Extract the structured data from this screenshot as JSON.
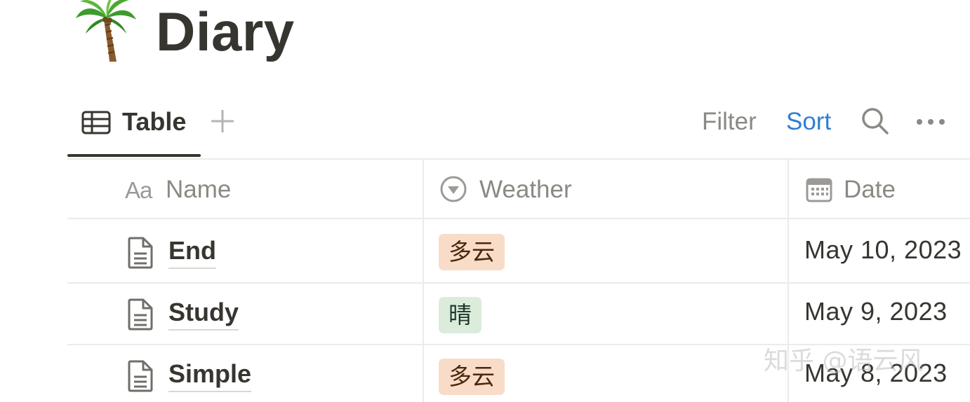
{
  "page": {
    "icon": "palm-tree-icon",
    "title": "Diary"
  },
  "view_bar": {
    "active_view": {
      "label": "Table",
      "icon": "table-icon"
    },
    "add_view_icon": "plus-icon",
    "filter_label": "Filter",
    "sort_label": "Sort",
    "search_icon": "search-icon",
    "more_icon": "more-horizontal-icon",
    "sort_color": "#2f7fd1"
  },
  "table": {
    "columns": [
      {
        "label": "Name",
        "icon_text": "Aa"
      },
      {
        "label": "Weather",
        "icon": "select-chevron-icon"
      },
      {
        "label": "Date",
        "icon": "calendar-icon"
      }
    ],
    "rows": [
      {
        "name": "End",
        "weather": "多云",
        "weather_color": "orange",
        "date": "May 10, 2023"
      },
      {
        "name": "Study",
        "weather": "晴",
        "weather_color": "green",
        "date": "May 9, 2023"
      },
      {
        "name": "Simple",
        "weather": "多云",
        "weather_color": "orange",
        "date": "May 8, 2023"
      }
    ]
  },
  "colors": {
    "text": "#37352f",
    "muted": "#8a8983",
    "tag_orange_bg": "#f9dcc8",
    "tag_green_bg": "#dbecdb"
  },
  "watermark": "知乎 @语云风"
}
